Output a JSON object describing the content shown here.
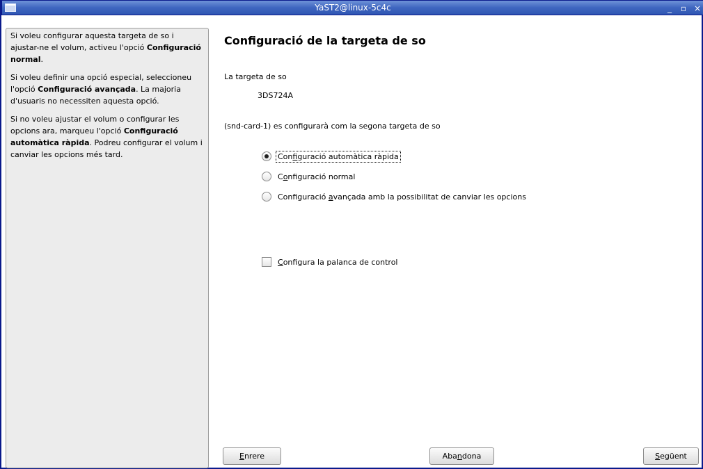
{
  "window": {
    "title": "YaST2@linux-5c4c",
    "controls": {
      "minimize": "_",
      "maximize": "▫",
      "close": "×"
    }
  },
  "help": {
    "p1": {
      "pre": "Si voleu configurar aquesta targeta de so i ajustar-ne el volum, activeu l'opció ",
      "bold": "Configuració normal",
      "post": "."
    },
    "p2": {
      "pre": "Si voleu definir una opció especial, seleccioneu l'opció ",
      "bold": "Configuració avançada",
      "post": ". La majoria d'usuaris no necessiten aquesta opció."
    },
    "p3": {
      "pre": "Si no voleu ajustar el volum o configurar les opcions ara, marqueu l'opció ",
      "bold": "Configuració automàtica ràpida",
      "post": ". Podreu configurar el volum i canviar les opcions més tard."
    }
  },
  "main": {
    "title": "Configuració de la targeta de so",
    "card_label": "La targeta de so",
    "card_name": "3DS724A",
    "config_note": "(snd-card-1) es configurarà com la segona targeta de so",
    "options": [
      {
        "pre": "Con",
        "mn": "f",
        "post": "iguració automàtica ràpida",
        "selected": true
      },
      {
        "pre": "C",
        "mn": "o",
        "post": "nfiguració normal",
        "selected": false
      },
      {
        "pre": "Configuració ",
        "mn": "a",
        "post": "vançada amb la possibilitat de canviar les opcions",
        "selected": false
      }
    ],
    "joystick": {
      "pre": "",
      "mn": "C",
      "post": "onfigura la palanca de control",
      "checked": false
    }
  },
  "buttons": {
    "back": {
      "pre": "",
      "mn": "E",
      "post": "nrere"
    },
    "abort": {
      "pre": "Aba",
      "mn": "n",
      "post": "dona"
    },
    "next": {
      "pre": "",
      "mn": "S",
      "post": "egüent"
    }
  }
}
